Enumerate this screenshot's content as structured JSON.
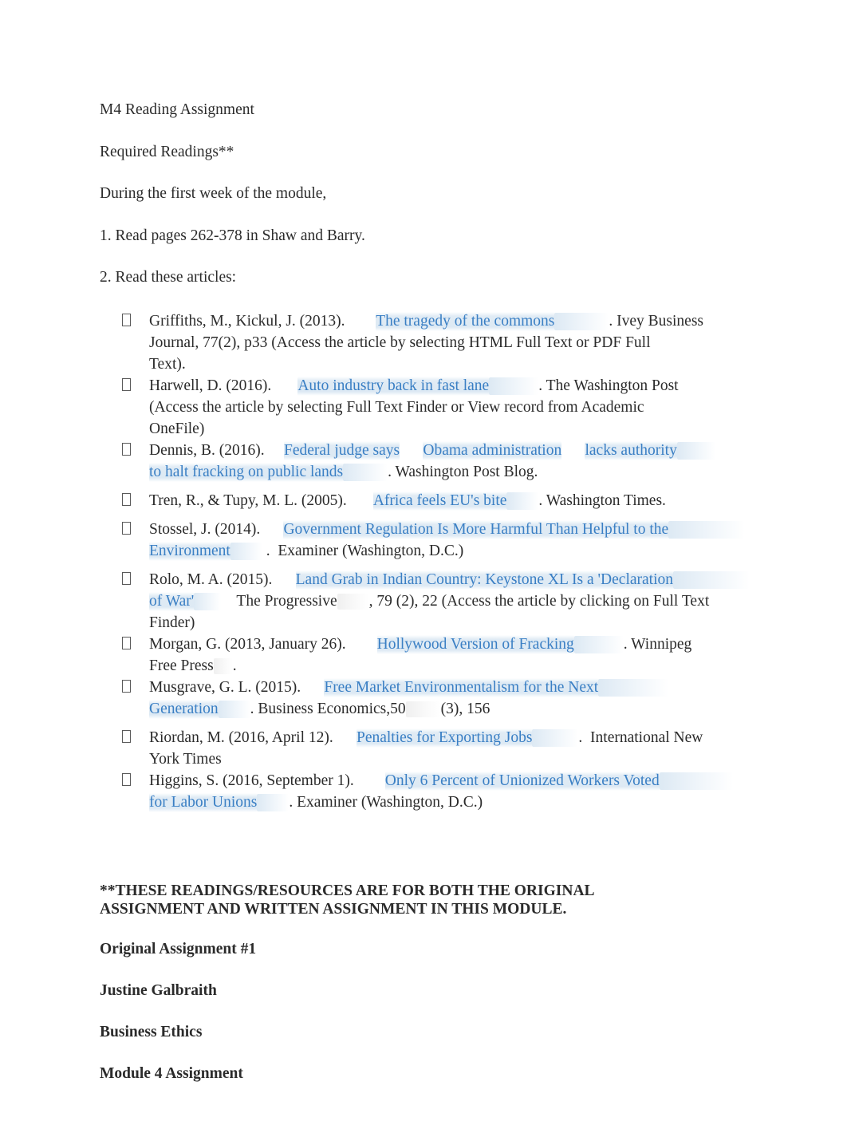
{
  "document": {
    "intro": [
      {
        "id": "title",
        "text": "M4 Reading Assignment"
      },
      {
        "id": "required",
        "text": "Required Readings**"
      },
      {
        "id": "during",
        "text": "During the first week of the module,"
      },
      {
        "id": "item1",
        "text": "1. Read pages 262-378 in Shaw and Barry."
      },
      {
        "id": "item2",
        "text": "2. Read these articles:"
      }
    ],
    "references": [
      {
        "id": "griffiths",
        "bullet": "bullet-box-glyph",
        "runs": [
          {
            "type": "text",
            "value": "Griffiths, M., Kickul, J. (2013).        "
          },
          {
            "type": "link",
            "value": "The tragedy of the commons",
            "tail": 68
          },
          {
            "type": "text",
            "value": ". Ivey Business"
          },
          {
            "type": "break"
          },
          {
            "type": "text",
            "value": "Journal, 77(2), p33 (Access the article by selecting HTML Full Text or PDF Full"
          },
          {
            "type": "break"
          },
          {
            "type": "text",
            "value": "Text)."
          }
        ]
      },
      {
        "id": "harwell",
        "bullet": "bullet-box-glyph",
        "runs": [
          {
            "type": "text",
            "value": "Harwell, D. (2016).       "
          },
          {
            "type": "link",
            "value": "Auto industry back in fast lane",
            "tail": 62
          },
          {
            "type": "text",
            "value": ". The Washington Post"
          },
          {
            "type": "break"
          },
          {
            "type": "text",
            "value": "(Access the article by selecting Full Text Finder or View record from Academic"
          },
          {
            "type": "break"
          },
          {
            "type": "text",
            "value": "OneFile)"
          }
        ]
      },
      {
        "id": "dennis",
        "bullet": "bullet-box-glyph",
        "runs": [
          {
            "type": "text",
            "value": "Dennis, B. (2016).     "
          },
          {
            "type": "link",
            "value": "Federal judge says",
            "tail": 0
          },
          {
            "type": "text",
            "value": "      "
          },
          {
            "type": "link",
            "value": "Obama administration",
            "tail": 0
          },
          {
            "type": "text",
            "value": "      "
          },
          {
            "type": "link",
            "value": "lacks authority",
            "tail": 48
          },
          {
            "type": "break"
          },
          {
            "type": "link",
            "value": "to halt fracking on public lands",
            "tail": 56
          },
          {
            "type": "text",
            "value": ". Washington Post Blog."
          }
        ]
      },
      {
        "id": "tren",
        "bullet": "bullet-box-glyph",
        "runs": [
          {
            "type": "text",
            "value": "Tren, R., & Tupy, M. L. (2005).       "
          },
          {
            "type": "link",
            "value": "Africa feels EU's bite",
            "tail": 40
          },
          {
            "type": "text",
            "value": ". Washington Times."
          }
        ]
      },
      {
        "id": "stossel",
        "bullet": "bullet-box-glyph",
        "runs": [
          {
            "type": "text",
            "value": "Stossel, J. (2014).      "
          },
          {
            "type": "link",
            "value": "Government Regulation Is More Harmful Than Helpful to the",
            "tail": 96
          },
          {
            "type": "break"
          },
          {
            "type": "link",
            "value": "Environment",
            "tail": 40
          },
          {
            "type": "text",
            "value": " .  Examiner (Washington, D.C.)"
          }
        ]
      },
      {
        "id": "rolo",
        "bullet": "bullet-box-glyph",
        "runs": [
          {
            "type": "text",
            "value": "Rolo, M. A. (2015).      "
          },
          {
            "type": "link",
            "value": "Land Grab in Indian Country: Keystone XL Is a 'Declaration",
            "tail": 96
          },
          {
            "type": "break"
          },
          {
            "type": "link",
            "value": "of War'",
            "tail": 34
          },
          {
            "type": "text",
            "value": "    The Progressive"
          },
          {
            "type": "plain",
            "value": "",
            "tail": 40
          },
          {
            "type": "text",
            "value": ", 79 (2), 22 (Access the article by clicking on Full Text"
          },
          {
            "type": "break"
          },
          {
            "type": "text",
            "value": "Finder)"
          }
        ]
      },
      {
        "id": "morgan",
        "bullet": "bullet-box-glyph",
        "runs": [
          {
            "type": "text",
            "value": "Morgan, G. (2013, January 26).        "
          },
          {
            "type": "link",
            "value": "Hollywood Version of Fracking",
            "tail": 62
          },
          {
            "type": "text",
            "value": ". Winnipeg"
          },
          {
            "type": "break"
          },
          {
            "type": "text",
            "value": "Free Press"
          },
          {
            "type": "plain",
            "value": "",
            "tail": 24
          },
          {
            "type": "text",
            "value": "."
          }
        ]
      },
      {
        "id": "musgrave",
        "bullet": "bullet-box-glyph",
        "runs": [
          {
            "type": "text",
            "value": "Musgrave, G. L. (2015).      "
          },
          {
            "type": "link",
            "value": "Free Market Environmentalism for the Next",
            "tail": 88
          },
          {
            "type": "break"
          },
          {
            "type": "link",
            "value": "Generation",
            "tail": 40
          },
          {
            "type": "text",
            "value": ". Business Economics,50"
          },
          {
            "type": "plain",
            "value": "",
            "tail": 44
          },
          {
            "type": "text",
            "value": "(3), 156"
          }
        ]
      },
      {
        "id": "riordan",
        "bullet": "bullet-box-glyph",
        "runs": [
          {
            "type": "text",
            "value": "Riordan, M. (2016, April 12).      "
          },
          {
            "type": "link",
            "value": "Penalties for Exporting Jobs",
            "tail": 58
          },
          {
            "type": "text",
            "value": ".  International New"
          },
          {
            "type": "break"
          },
          {
            "type": "text",
            "value": "York Times"
          }
        ]
      },
      {
        "id": "higgins",
        "bullet": "bullet-box-glyph",
        "runs": [
          {
            "type": "text",
            "value": "Higgins, S. (2016, September 1).        "
          },
          {
            "type": "link",
            "value": "Only 6 Percent of Unionized Workers Voted",
            "tail": 92
          },
          {
            "type": "break"
          },
          {
            "type": "link",
            "value": "for Labor Unions",
            "tail": 40
          },
          {
            "type": "text",
            "value": ". Examiner (Washington, D.C.)"
          }
        ]
      }
    ],
    "footer": {
      "note": "**THESE READINGS/RESOURCES ARE FOR BOTH THE ORIGINAL\nASSIGNMENT AND WRITTEN ASSIGNMENT IN THIS MODULE.",
      "lines": [
        {
          "id": "original-assignment",
          "text": "Original Assignment #1",
          "shadowed": true
        },
        {
          "id": "student-name",
          "text": "Justine Galbraith",
          "shadowed": false
        },
        {
          "id": "course-name",
          "text": "Business Ethics",
          "shadowed": false
        },
        {
          "id": "module-assignment",
          "text": "Module 4 Assignment",
          "shadowed": false
        }
      ]
    }
  },
  "colors": {
    "link": "#3a7fc4",
    "text": "#2b2b2b",
    "highlight": "#dbe8f3",
    "page_background": "#ffffff"
  }
}
